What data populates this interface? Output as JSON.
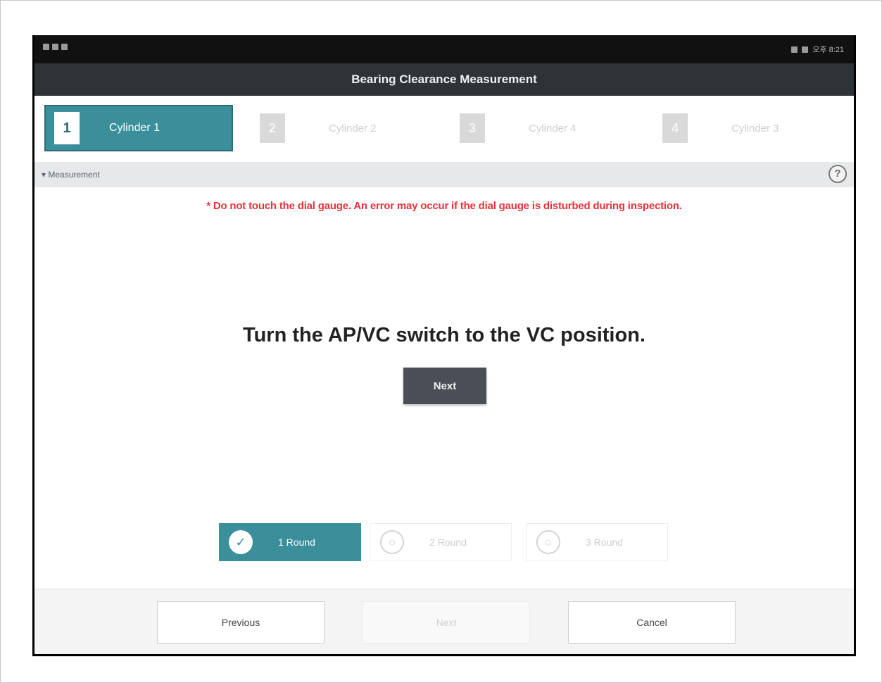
{
  "status_bar": {
    "time": "오후 8:21"
  },
  "title": "Bearing Clearance Measurement",
  "steps": [
    {
      "number": "1",
      "label": "Cylinder 1"
    },
    {
      "number": "2",
      "label": "Cylinder 2"
    },
    {
      "number": "3",
      "label": "Cylinder 4"
    },
    {
      "number": "4",
      "label": "Cylinder 3"
    }
  ],
  "section": {
    "title": "▾ Measurement",
    "help_symbol": "?"
  },
  "warning": "* Do not touch the dial gauge. An error may occur if the dial gauge is disturbed during inspection.",
  "instruction": "Turn the AP/VC switch to the VC position.",
  "next_inline_label": "Next",
  "rounds": [
    {
      "label": "1 Round",
      "icon": "✓"
    },
    {
      "label": "2 Round",
      "icon": "○"
    },
    {
      "label": "3 Round",
      "icon": "○"
    }
  ],
  "footer": {
    "previous": "Previous",
    "next": "Next",
    "cancel": "Cancel"
  },
  "colors": {
    "accent": "#3a8f9a",
    "header": "#2e3338",
    "warning": "#e8323c"
  }
}
